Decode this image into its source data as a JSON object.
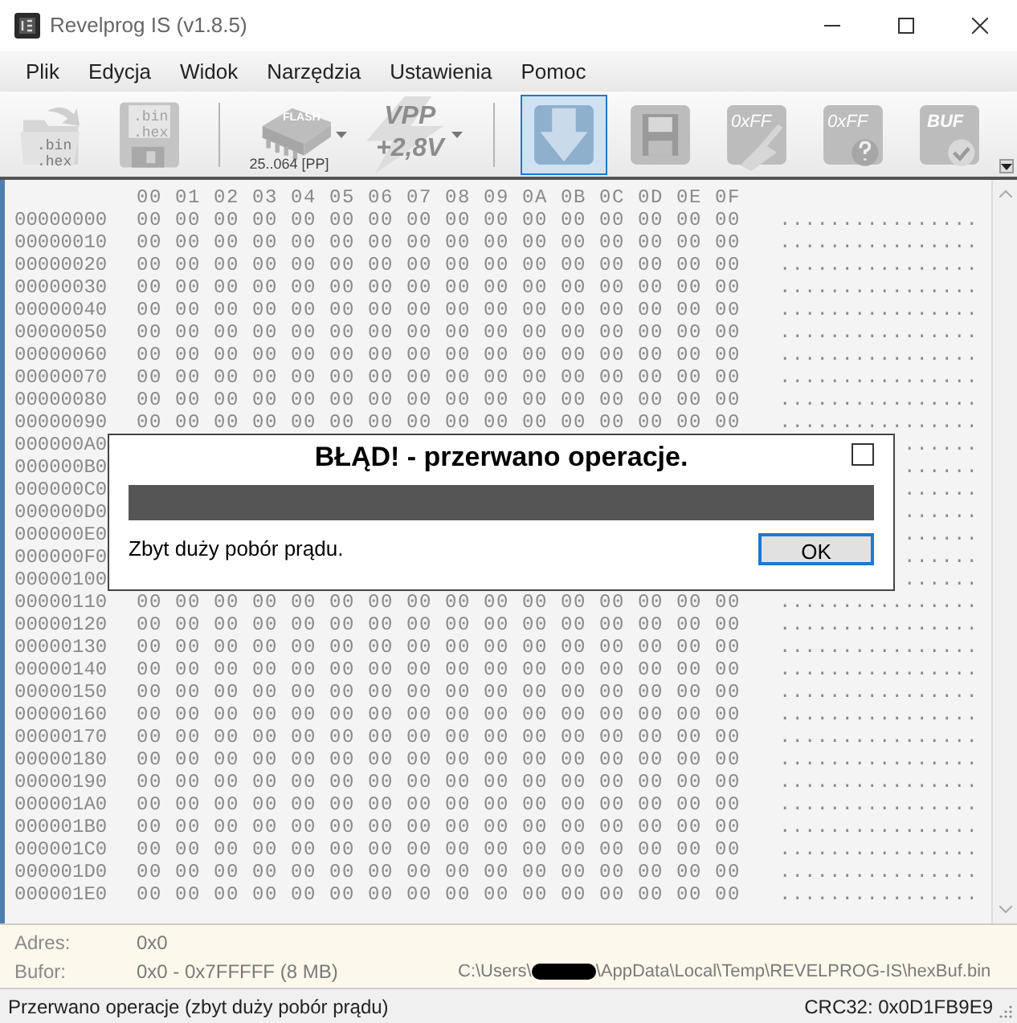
{
  "window": {
    "title": "Revelprog IS (v1.8.5)"
  },
  "menu": [
    "Plik",
    "Edycja",
    "Widok",
    "Narzędzia",
    "Ustawienia",
    "Pomoc"
  ],
  "toolbar": [
    {
      "kind": "open",
      "labels": [
        ".bin",
        ".hex"
      ],
      "selected": false,
      "dropdown": false
    },
    {
      "kind": "save",
      "labels": [
        ".bin",
        ".hex"
      ],
      "selected": false,
      "dropdown": false
    },
    {
      "kind": "separator"
    },
    {
      "kind": "chip",
      "labels": [
        "FLASH"
      ],
      "caption": "25..064 [PP]",
      "selected": false,
      "dropdown": true
    },
    {
      "kind": "vpp",
      "labels": [
        "VPP",
        "+2,8V"
      ],
      "selected": false,
      "dropdown": true
    },
    {
      "kind": "separator"
    },
    {
      "kind": "read",
      "selected": true,
      "dropdown": false
    },
    {
      "kind": "write",
      "selected": false,
      "dropdown": false
    },
    {
      "kind": "erase",
      "labels": [
        "0xFF"
      ],
      "selected": false,
      "dropdown": false
    },
    {
      "kind": "blank",
      "labels": [
        "0xFF"
      ],
      "selected": false,
      "dropdown": false
    },
    {
      "kind": "verify",
      "labels": [
        "BUF"
      ],
      "selected": false,
      "dropdown": false
    }
  ],
  "hex_view": {
    "header": "00 01 02 03 04 05 06 07 08 09 0A 0B 0C 0D 0E 0F",
    "rows": [
      {
        "address": "00000000",
        "bytes": "00 00 00 00 00 00 00 00 00 00 00 00 00 00 00 00",
        "ascii": "................"
      },
      {
        "address": "00000010",
        "bytes": "00 00 00 00 00 00 00 00 00 00 00 00 00 00 00 00",
        "ascii": "................"
      },
      {
        "address": "00000020",
        "bytes": "00 00 00 00 00 00 00 00 00 00 00 00 00 00 00 00",
        "ascii": "................"
      },
      {
        "address": "00000030",
        "bytes": "00 00 00 00 00 00 00 00 00 00 00 00 00 00 00 00",
        "ascii": "................"
      },
      {
        "address": "00000040",
        "bytes": "00 00 00 00 00 00 00 00 00 00 00 00 00 00 00 00",
        "ascii": "................"
      },
      {
        "address": "00000050",
        "bytes": "00 00 00 00 00 00 00 00 00 00 00 00 00 00 00 00",
        "ascii": "................"
      },
      {
        "address": "00000060",
        "bytes": "00 00 00 00 00 00 00 00 00 00 00 00 00 00 00 00",
        "ascii": "................"
      },
      {
        "address": "00000070",
        "bytes": "00 00 00 00 00 00 00 00 00 00 00 00 00 00 00 00",
        "ascii": "................"
      },
      {
        "address": "00000080",
        "bytes": "00 00 00 00 00 00 00 00 00 00 00 00 00 00 00 00",
        "ascii": "................"
      },
      {
        "address": "00000090",
        "bytes": "00 00 00 00 00 00 00 00 00 00 00 00 00 00 00 00",
        "ascii": "................"
      },
      {
        "address": "000000A0",
        "ascii": "......"
      },
      {
        "address": "000000B0",
        "ascii": "......"
      },
      {
        "address": "000000C0",
        "ascii": "......"
      },
      {
        "address": "000000D0",
        "ascii": "......"
      },
      {
        "address": "000000E0",
        "ascii": "......"
      },
      {
        "address": "000000F0",
        "ascii": "......"
      },
      {
        "address": "00000100",
        "ascii": "......"
      },
      {
        "address": "00000110",
        "bytes": "00 00 00 00 00 00 00 00 00 00 00 00 00 00 00 00",
        "ascii": "................"
      },
      {
        "address": "00000120",
        "bytes": "00 00 00 00 00 00 00 00 00 00 00 00 00 00 00 00",
        "ascii": "................"
      },
      {
        "address": "00000130",
        "bytes": "00 00 00 00 00 00 00 00 00 00 00 00 00 00 00 00",
        "ascii": "................"
      },
      {
        "address": "00000140",
        "bytes": "00 00 00 00 00 00 00 00 00 00 00 00 00 00 00 00",
        "ascii": "................"
      },
      {
        "address": "00000150",
        "bytes": "00 00 00 00 00 00 00 00 00 00 00 00 00 00 00 00",
        "ascii": "................"
      },
      {
        "address": "00000160",
        "bytes": "00 00 00 00 00 00 00 00 00 00 00 00 00 00 00 00",
        "ascii": "................"
      },
      {
        "address": "00000170",
        "bytes": "00 00 00 00 00 00 00 00 00 00 00 00 00 00 00 00",
        "ascii": "................"
      },
      {
        "address": "00000180",
        "bytes": "00 00 00 00 00 00 00 00 00 00 00 00 00 00 00 00",
        "ascii": "................"
      },
      {
        "address": "00000190",
        "bytes": "00 00 00 00 00 00 00 00 00 00 00 00 00 00 00 00",
        "ascii": "................"
      },
      {
        "address": "000001A0",
        "bytes": "00 00 00 00 00 00 00 00 00 00 00 00 00 00 00 00",
        "ascii": "................"
      },
      {
        "address": "000001B0",
        "bytes": "00 00 00 00 00 00 00 00 00 00 00 00 00 00 00 00",
        "ascii": "................"
      },
      {
        "address": "000001C0",
        "bytes": "00 00 00 00 00 00 00 00 00 00 00 00 00 00 00 00",
        "ascii": "................"
      },
      {
        "address": "000001D0",
        "bytes": "00 00 00 00 00 00 00 00 00 00 00 00 00 00 00 00",
        "ascii": "................"
      },
      {
        "address": "000001E0",
        "bytes": "00 00 00 00 00 00 00 00 00 00 00 00 00 00 00 00",
        "ascii": "................"
      }
    ]
  },
  "dialog": {
    "title": "BŁĄD! - przerwano operacje.",
    "checked": false,
    "message": "Zbyt duży pobór prądu.",
    "button": "OK",
    "button_focused": true
  },
  "info": [
    {
      "label": "Adres:",
      "value": "0x0"
    },
    {
      "label": "Bufor:",
      "value": "0x0 - 0x7FFFFF (8 MB)",
      "path_start": "C:\\Users\\",
      "redacted": true,
      "path_end": "\\AppData\\Local\\Temp\\REVELPROG-IS\\hexBuf.bin"
    }
  ],
  "status_bar": {
    "message": "Przerwano operacje (zbyt duży pobór prądu)",
    "crc": "CRC32: 0x0D1FB9E9"
  }
}
